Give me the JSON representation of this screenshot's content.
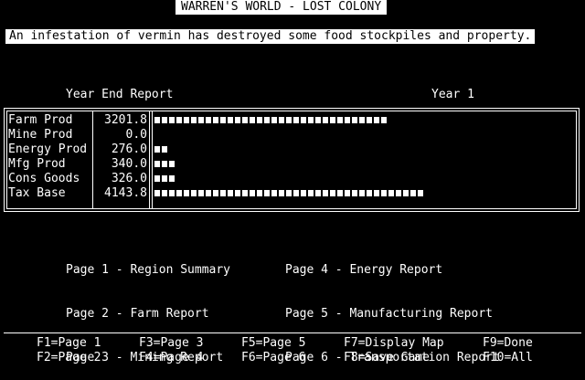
{
  "title": "WARREN'S WORLD - LOST COLONY",
  "event_message": "An infestation of vermin has destroyed some food stockpiles and property.",
  "report": {
    "heading": "Year End Report",
    "year_label": "Year 1",
    "rows": [
      {
        "label": "Farm Prod",
        "value": "3201.8",
        "bar_units": 32
      },
      {
        "label": "Mine Prod",
        "value": "0.0",
        "bar_units": 0
      },
      {
        "label": "Energy Prod",
        "value": "276.0",
        "bar_units": 2
      },
      {
        "label": "Mfg Prod",
        "value": "340.0",
        "bar_units": 3
      },
      {
        "label": "Cons Goods",
        "value": "326.0",
        "bar_units": 3
      },
      {
        "label": "Tax Base",
        "value": "4143.8",
        "bar_units": 37
      }
    ]
  },
  "pages": {
    "left": [
      "Page 1 - Region Summary",
      "Page 2 - Farm Report",
      "Page 3 - Mining Report"
    ],
    "right": [
      "Page 4 - Energy Report",
      "Page 5 - Manufacturing Report",
      "Page 6 - Transportation Report"
    ]
  },
  "function_keys": {
    "f1": "F1=Page 1",
    "f2": "F2=Page 2",
    "f3": "F3=Page 3",
    "f4": "F4=Page 4",
    "f5": "F5=Page 5",
    "f6": "F6=Page 6",
    "f7": "F7=Display Map",
    "f8": "F8=Save Game",
    "f9": "F9=Done",
    "f10": "F10=All"
  },
  "colors": {
    "background": "#000000",
    "foreground": "#ffffff"
  }
}
